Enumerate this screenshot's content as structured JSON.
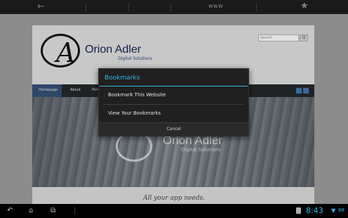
{
  "topbar": {
    "back_icon": "arrow-left-icon",
    "url_text": "www",
    "bookmark_icon": "star-icon"
  },
  "website": {
    "logo_initials": "A",
    "brand_name": "Orion Adler",
    "brand_subtitle": "Digital Solutions",
    "search_placeholder": "Search",
    "search_button": "Q",
    "nav": [
      "Homepage",
      "About",
      "Portf"
    ],
    "banner_name": "Orion Adler",
    "banner_subtitle": "Digital Solutions",
    "tagline": "All your app needs."
  },
  "dialog": {
    "title": "Bookmarks",
    "items": [
      {
        "label": "Bookmark This Website"
      },
      {
        "label": "View Your Bookmarks"
      }
    ],
    "cancel_label": "Cancel"
  },
  "systembar": {
    "time": "8:43",
    "battery": "88",
    "icons": [
      "back-icon",
      "home-icon",
      "recent-apps-icon",
      "menu-icon"
    ],
    "accent": "#33b5e5"
  }
}
